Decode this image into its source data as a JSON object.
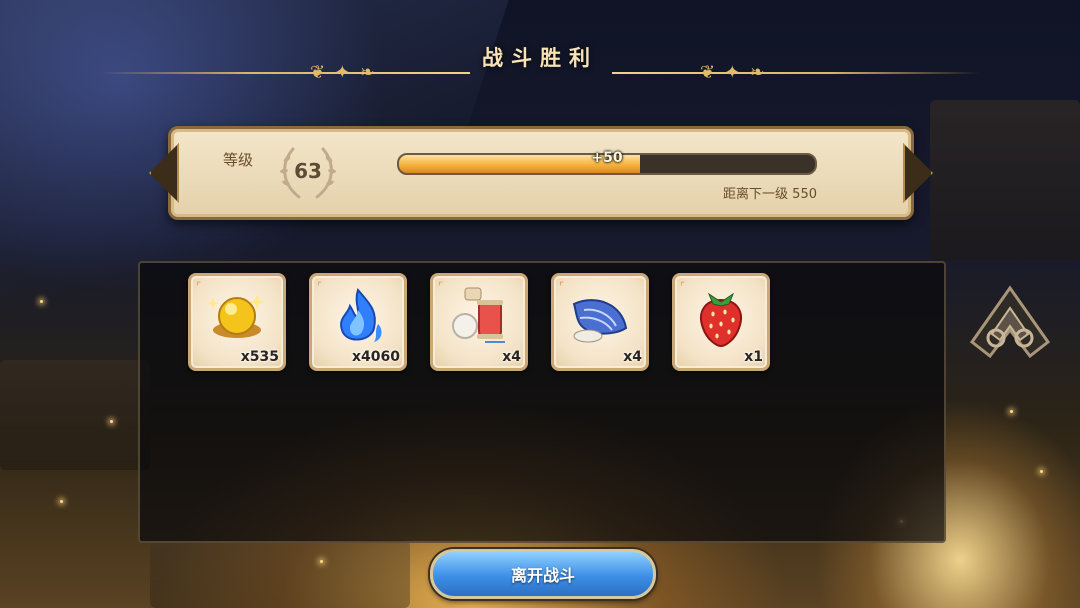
{
  "title": "战斗胜利",
  "level": {
    "label": "等级",
    "value": "63",
    "xp_gain": "+50",
    "progress_fraction": 0.58,
    "next_level_text": "距离下一级 550"
  },
  "rewards": [
    {
      "icon": "gold-orb-icon",
      "quantity": "x535"
    },
    {
      "icon": "blue-flame-icon",
      "quantity": "x4060"
    },
    {
      "icon": "thread-spool-icon",
      "quantity": "x4"
    },
    {
      "icon": "seashell-icon",
      "quantity": "x4"
    },
    {
      "icon": "strawberry-icon",
      "quantity": "x1"
    }
  ],
  "leave_button_label": "离开战斗",
  "colors": {
    "xp_fill": "#f5b23e",
    "button_blue": "#3d8fe6",
    "title_gold": "#f6e2b3"
  }
}
